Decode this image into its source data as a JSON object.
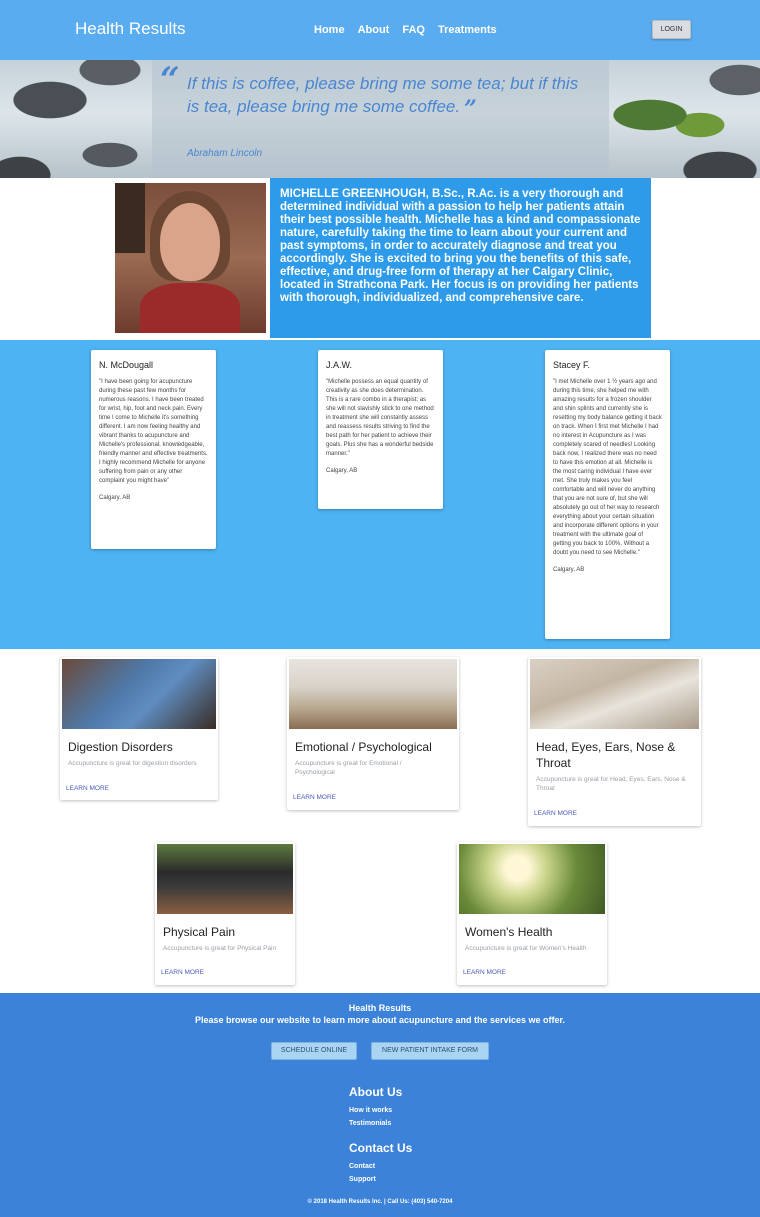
{
  "nav": {
    "brand": "Health Results",
    "links": [
      "Home",
      "About",
      "FAQ",
      "Treatments"
    ],
    "login_label": "LOGIN"
  },
  "hero": {
    "quote": "If this is coffee, please bring me some tea; but if this is tea, please bring me some coffee.",
    "author": "Abraham Lincoln"
  },
  "bio": {
    "text": "MICHELLE GREENHOUGH, B.Sc., R.Ac. is a very thorough and determined individual with a passion to help her patients attain their best possible health. Michelle has a kind and compassionate nature, carefully taking the time to learn about your current and past symptoms, in order to accurately diagnose and treat you accordingly. She is excited to bring you the benefits of this safe, effective, and drug-free form of therapy at her Calgary Clinic, located in Strathcona Park. Her focus is on providing her patients with thorough, individualized, and comprehensive care."
  },
  "testimonials": [
    {
      "name": "N. McDougall",
      "body": "\"I have been going for acupuncture during these past few months for numerous reasons. I have been treated for wrist, hip, foot and neck pain. Every time I come to Michelle it's something different. I am now feeling healthy and vibrant thanks to acupuncture and Michelle's professional, knowledgeable, friendly manner and effective treatments. I highly recommend Michelle for anyone suffering from pain or any other complaint you might have\"",
      "location": "Calgary, AB"
    },
    {
      "name": "J.A.W.",
      "body": "\"Michelle possess an equal quantity of creativity as she does determination. This is a rare combo in a therapist; as she will not slavishly stick to one method in treatment she will constantly assess and reassess results striving to find the best path for her patient to achieve their goals. Plus she has a wonderful bedside manner.\"",
      "location": "Calgary, AB"
    },
    {
      "name": "Stacey F.",
      "body": "\"I met Michelle over 1 ½ years ago and during this time, she helped me with amazing results for a frozen shoulder and shin splints and currently she is resetting my body balance getting it back on track. When I first met Michelle I had no interest in Acupuncture as I was completely scared of needles! Looking back now, I realized there was no need to have this emotion at all. Michelle is the most caring individual I have ever met. She truly makes you feel comfortable and will never do anything that you are not sure of, but she will absolutely go out of her way to research everything about your certain situation and incorporate different options in your treatment with the ultimate goal of getting you back to 100%. Without a doubt you need to see Michelle.\"",
      "location": "Calgary, AB"
    }
  ],
  "services": [
    {
      "title": "Digestion Disorders",
      "desc": "Accupuncture is great for digestion disorders",
      "link": "LEARN MORE"
    },
    {
      "title": "Emotional / Psychological",
      "desc": "Accupuncture is great for Emotional / Psychological",
      "link": "LEARN MORE"
    },
    {
      "title": "Head, Eyes, Ears, Nose & Throat",
      "desc": "Accupuncture is great for Head, Eyes, Ears, Nose & Throat",
      "link": "LEARN MORE"
    },
    {
      "title": "Physical Pain",
      "desc": "Accupuncture is great for Physical Pain",
      "link": "LEARN MORE"
    },
    {
      "title": "Women's Health",
      "desc": "Accupuncture is great for Women's Health",
      "link": "LEARN MORE"
    }
  ],
  "footer": {
    "title": "Health Results",
    "tagline": "Please browse our website to learn more about acupuncture and the services we offer.",
    "schedule_label": "SCHEDULE ONLINE",
    "intake_label": "NEW PATIENT INTAKE FORM",
    "about_heading": "About Us",
    "about_links": [
      "How it works",
      "Testimonials"
    ],
    "contact_heading": "Contact Us",
    "contact_links": [
      "Contact",
      "Support"
    ],
    "copyright": "© 2018 Health Results Inc. | Call Us: (403) 540-7204"
  }
}
